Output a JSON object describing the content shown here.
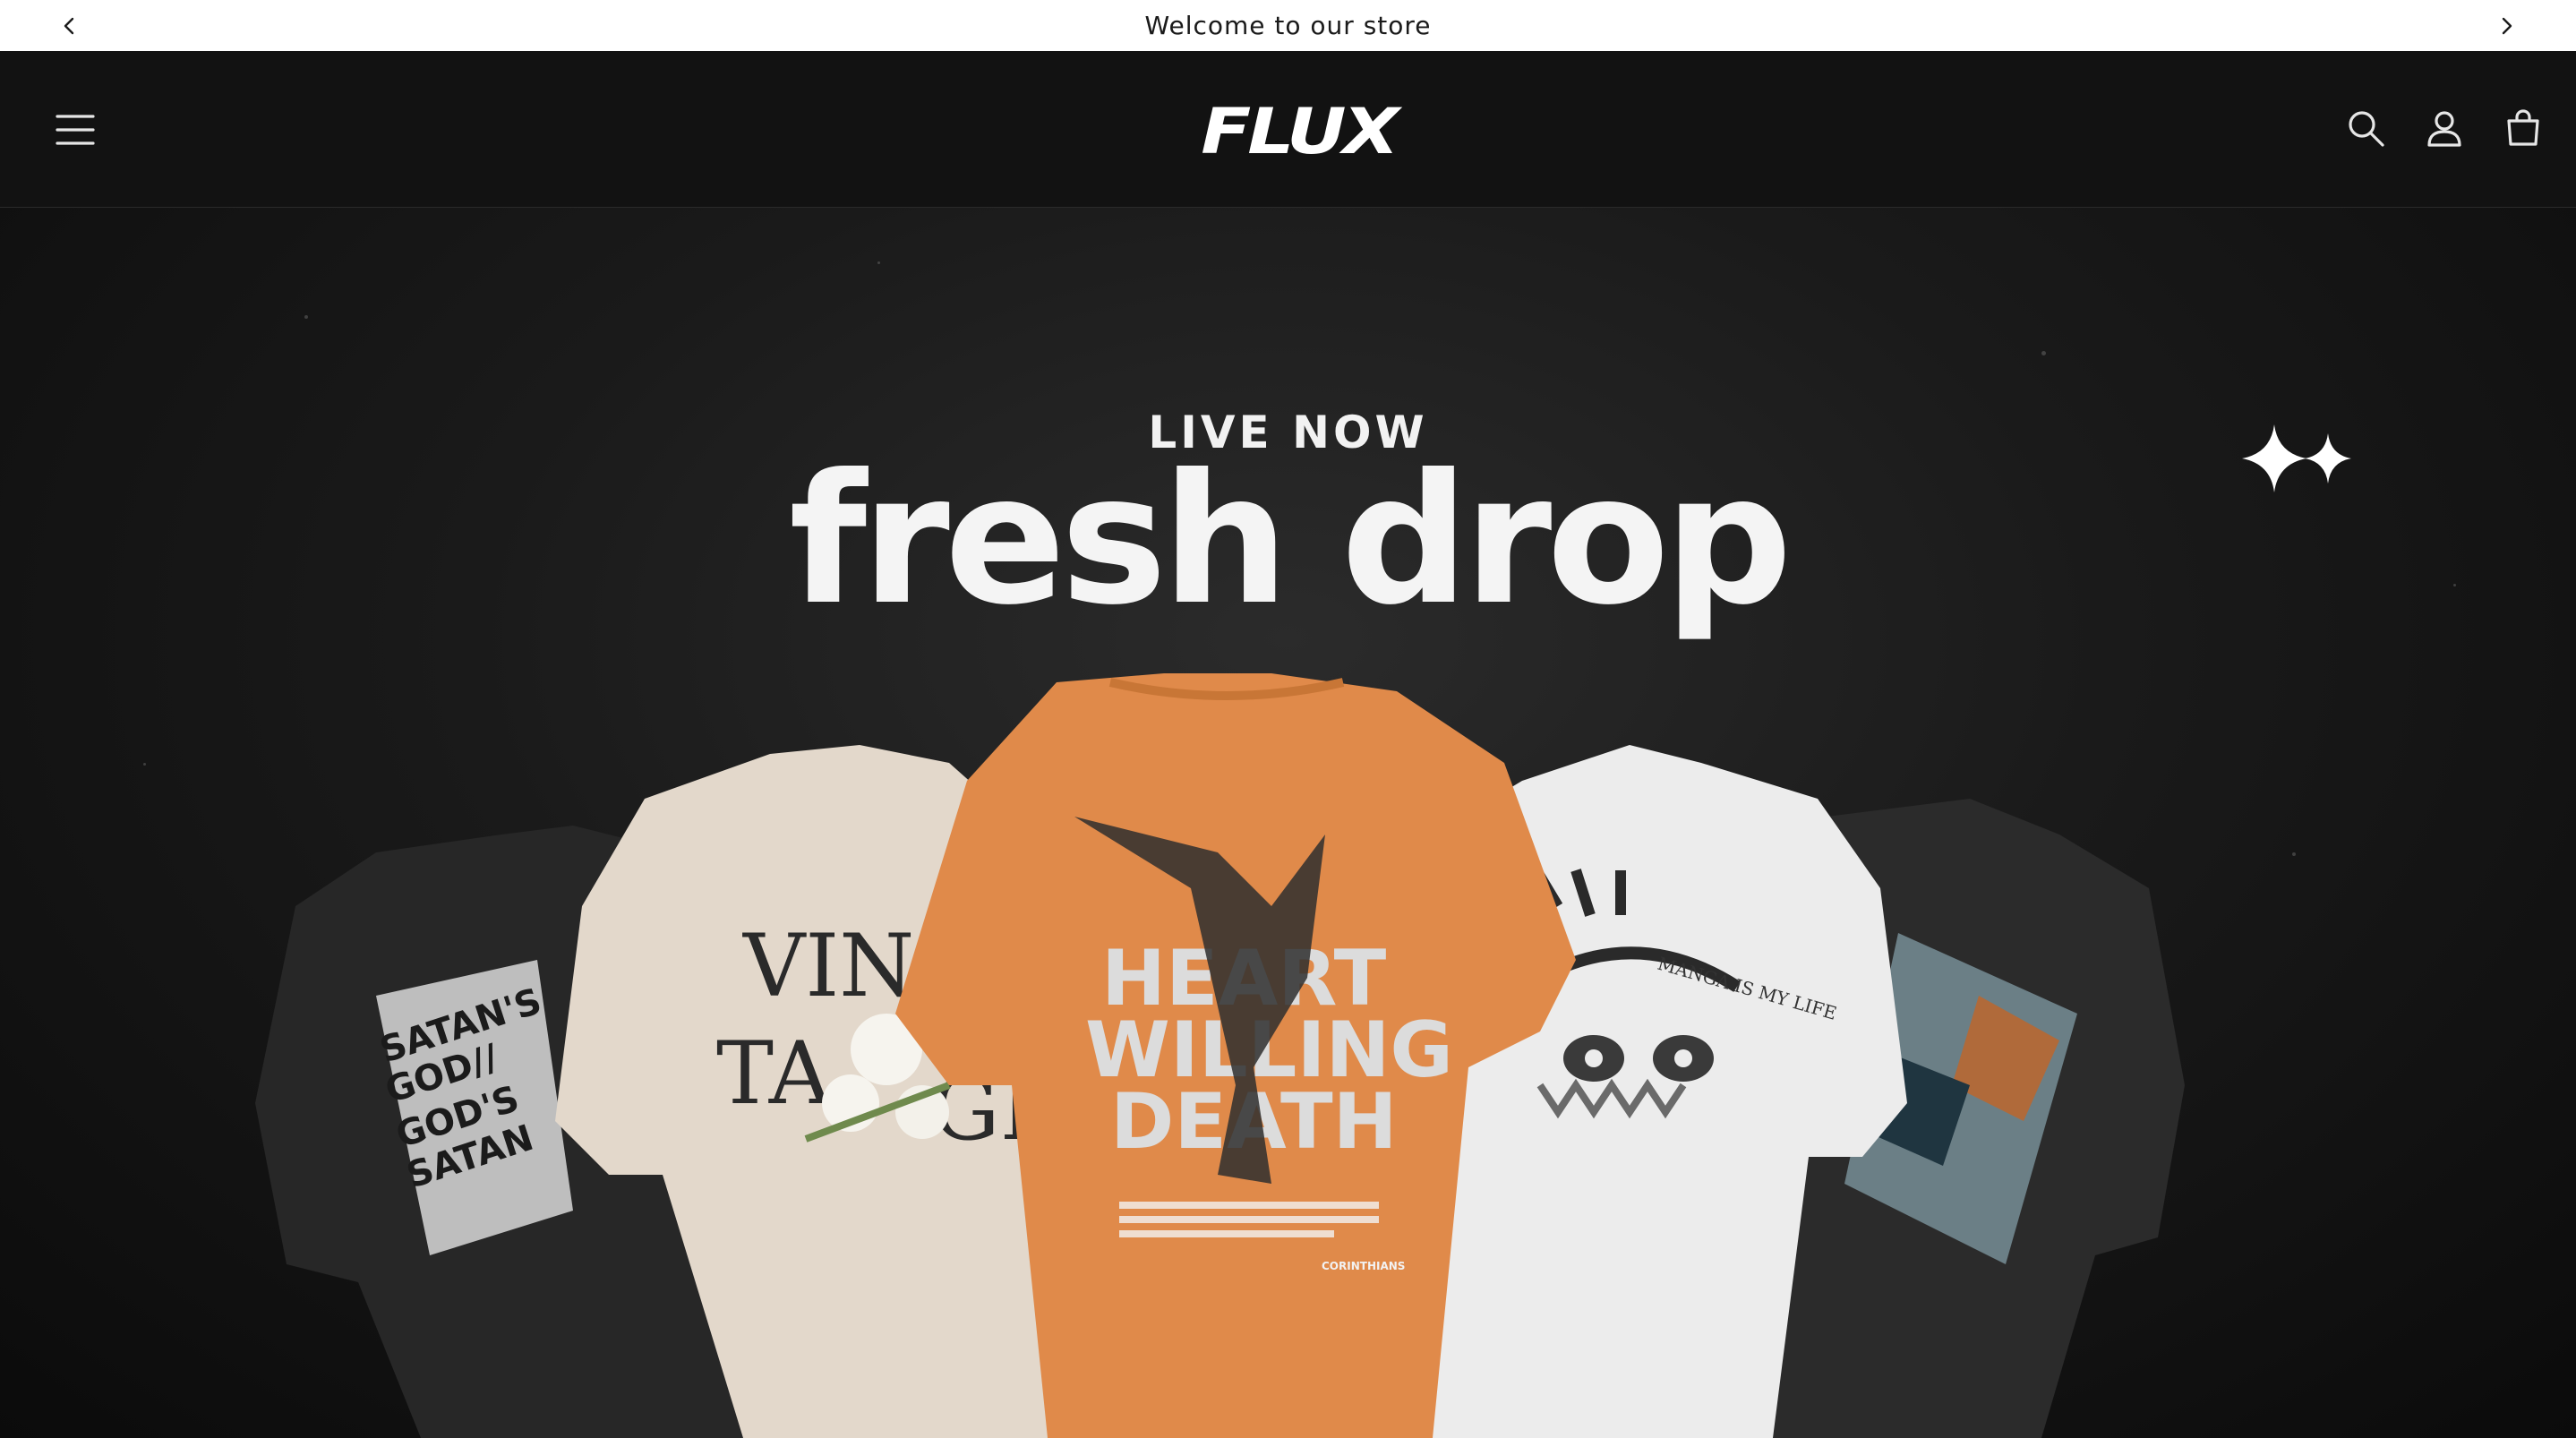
{
  "announcement": {
    "text": "Welcome to our store",
    "prev_icon": "chevron-left-icon",
    "next_icon": "chevron-right-icon"
  },
  "header": {
    "menu_icon": "hamburger-menu-icon",
    "logo_text": "FLUX",
    "search_icon": "search-icon",
    "account_icon": "account-icon",
    "cart_icon": "cart-icon"
  },
  "hero": {
    "kicker": "LIVE NOW",
    "headline": "fresh drop",
    "sparkle_icon": "sparkle-icon",
    "colors": {
      "background": "#121212",
      "orange_shirt": "#e08a4a",
      "cream_shirt": "#e3d8cb",
      "white_shirt": "#ededed",
      "black_shirt": "#262626"
    },
    "shirts": [
      {
        "name": "black-shirt-left",
        "print": [
          "SATAN'S",
          "GOD//",
          "GOD'S",
          "SATAN"
        ]
      },
      {
        "name": "cream-shirt",
        "print": [
          "VIN",
          "TA",
          "GE"
        ]
      },
      {
        "name": "orange-shirt",
        "print": [
          "HEART",
          "WILLING",
          "DEATH"
        ],
        "footer": "CORINTHIANS"
      },
      {
        "name": "white-shirt",
        "print": [
          "MANGA IS MY LIFE"
        ]
      },
      {
        "name": "black-shirt-right",
        "print": []
      }
    ]
  }
}
